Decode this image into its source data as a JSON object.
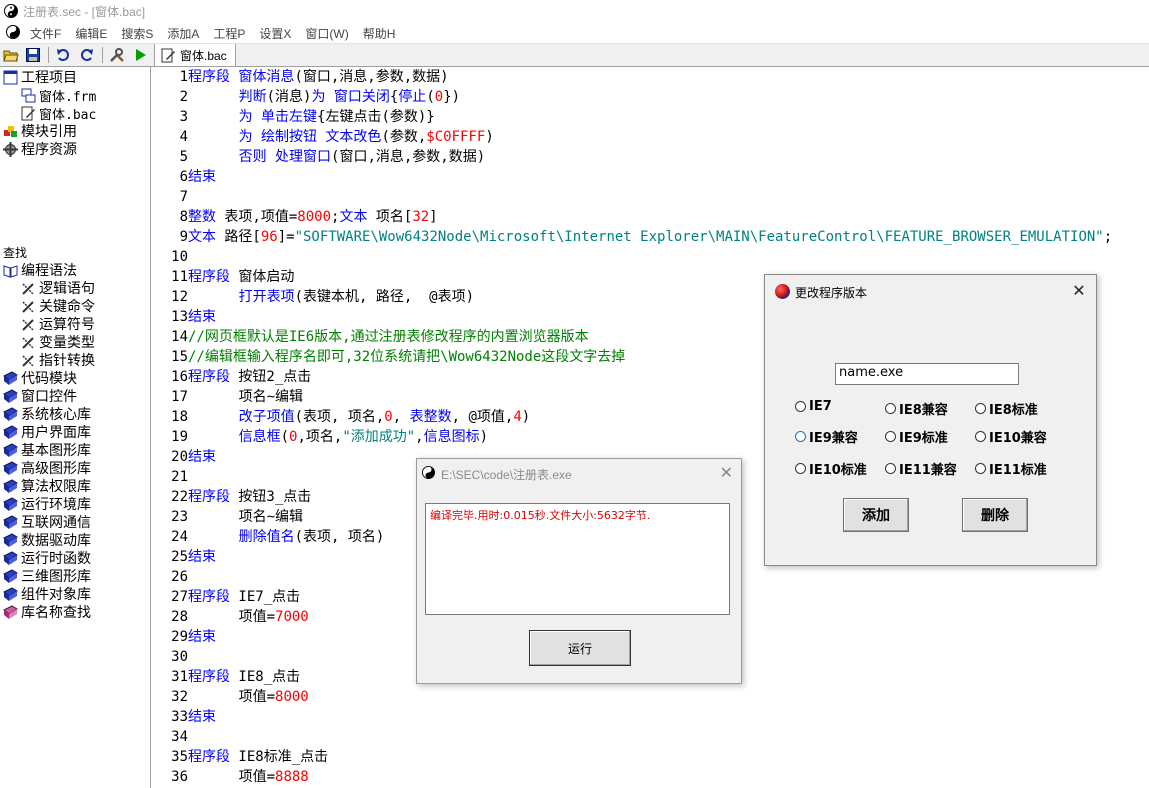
{
  "window": {
    "title": "注册表.sec - [窗体.bac]"
  },
  "menu": [
    "文件F",
    "编辑E",
    "搜索S",
    "添加A",
    "工程P",
    "设置X",
    "窗口(W)",
    "帮助H"
  ],
  "toolbar": {
    "tab_label": "窗体.bac"
  },
  "project_tree": {
    "root": "工程项目",
    "files": [
      "窗体.frm",
      "窗体.bac"
    ],
    "items": [
      "模块引用",
      "程序资源"
    ]
  },
  "search": {
    "label": "查找"
  },
  "lib_tree": {
    "root": "编程语法",
    "syntax_items": [
      "逻辑语句",
      "关键命令",
      "运算符号",
      "变量类型",
      "指针转换"
    ],
    "libraries": [
      "代码模块",
      "窗口控件",
      "系统核心库",
      "用户界面库",
      "基本图形库",
      "高级图形库",
      "算法权限库",
      "运行环境库",
      "互联网通信",
      "数据驱动库",
      "运行时函数",
      "三维图形库",
      "组件对象库"
    ],
    "last": "库名称查找"
  },
  "code_lines": [
    {
      "n": "1",
      "parts": [
        [
          "kw",
          "程序段 窗体消息"
        ],
        [
          "",
          "(窗口,消息,参数,数据)"
        ]
      ]
    },
    {
      "n": "2",
      "parts": [
        [
          "",
          "      "
        ],
        [
          "kw",
          "判断"
        ],
        [
          "",
          "(消息)"
        ],
        [
          "kw",
          "为 窗口关闭"
        ],
        [
          "",
          "{"
        ],
        [
          "kw",
          "停止"
        ],
        [
          "",
          "("
        ],
        [
          "num",
          "0"
        ],
        [
          "",
          "})"
        ]
      ]
    },
    {
      "n": "3",
      "parts": [
        [
          "",
          "      "
        ],
        [
          "kw",
          "为 单击左键"
        ],
        [
          "",
          "{左键点击(参数)}"
        ]
      ]
    },
    {
      "n": "4",
      "parts": [
        [
          "",
          "      "
        ],
        [
          "kw",
          "为 绘制按钮 文本改色"
        ],
        [
          "",
          "(参数,"
        ],
        [
          "num",
          "$C0FFFF"
        ],
        [
          "",
          ")"
        ]
      ]
    },
    {
      "n": "5",
      "parts": [
        [
          "",
          "      "
        ],
        [
          "kw",
          "否则 处理窗口"
        ],
        [
          "",
          "(窗口,消息,参数,数据)"
        ]
      ]
    },
    {
      "n": "6",
      "parts": [
        [
          "kw",
          "结束"
        ]
      ]
    },
    {
      "n": "7",
      "parts": []
    },
    {
      "n": "8",
      "parts": [
        [
          "kw",
          "整数"
        ],
        [
          "",
          " 表项,项值="
        ],
        [
          "num",
          "8000"
        ],
        [
          "",
          ";"
        ],
        [
          "kw",
          "文本"
        ],
        [
          "",
          " 项名["
        ],
        [
          "num",
          "32"
        ],
        [
          "",
          "]"
        ]
      ]
    },
    {
      "n": "9",
      "parts": [
        [
          "kw",
          "文本"
        ],
        [
          "",
          " 路径["
        ],
        [
          "num",
          "96"
        ],
        [
          "",
          "]="
        ],
        [
          "str",
          "\"SOFTWARE\\Wow6432Node\\Microsoft\\Internet Explorer\\MAIN\\FeatureControl\\FEATURE_BROWSER_EMULATION\""
        ],
        [
          "",
          ";"
        ]
      ]
    },
    {
      "n": "10",
      "parts": []
    },
    {
      "n": "11",
      "parts": [
        [
          "kw",
          "程序段"
        ],
        [
          "",
          " 窗体启动"
        ]
      ]
    },
    {
      "n": "12",
      "parts": [
        [
          "",
          "      "
        ],
        [
          "kw",
          "打开表项"
        ],
        [
          "",
          "(表键本机, 路径,  @表项)"
        ]
      ]
    },
    {
      "n": "13",
      "parts": [
        [
          "kw",
          "结束"
        ]
      ]
    },
    {
      "n": "14",
      "parts": [
        [
          "cmt",
          "//网页框默认是IE6版本,通过注册表修改程序的内置浏览器版本"
        ]
      ]
    },
    {
      "n": "15",
      "parts": [
        [
          "cmt",
          "//编辑框输入程序名即可,32位系统请把\\Wow6432Node这段文字去掉"
        ]
      ]
    },
    {
      "n": "16",
      "parts": [
        [
          "kw",
          "程序段"
        ],
        [
          "",
          " 按钮2_点击"
        ]
      ]
    },
    {
      "n": "17",
      "parts": [
        [
          "",
          "      项名~编辑"
        ]
      ]
    },
    {
      "n": "18",
      "parts": [
        [
          "",
          "      "
        ],
        [
          "kw",
          "改子项值"
        ],
        [
          "",
          "(表项, 项名,"
        ],
        [
          "num",
          "0"
        ],
        [
          "",
          ", "
        ],
        [
          "kw",
          "表整数"
        ],
        [
          "",
          ", @项值,"
        ],
        [
          "num",
          "4"
        ],
        [
          "",
          ")"
        ]
      ]
    },
    {
      "n": "19",
      "parts": [
        [
          "",
          "      "
        ],
        [
          "kw",
          "信息框"
        ],
        [
          "",
          "("
        ],
        [
          "num",
          "0"
        ],
        [
          "",
          ",项名,"
        ],
        [
          "str",
          "\"添加成功\""
        ],
        [
          "",
          ","
        ],
        [
          "kw",
          "信息图标"
        ],
        [
          "",
          ")"
        ]
      ]
    },
    {
      "n": "20",
      "parts": [
        [
          "kw",
          "结束"
        ]
      ]
    },
    {
      "n": "21",
      "parts": []
    },
    {
      "n": "22",
      "parts": [
        [
          "kw",
          "程序段"
        ],
        [
          "",
          " 按钮3_点击"
        ]
      ]
    },
    {
      "n": "23",
      "parts": [
        [
          "",
          "      项名~编辑"
        ]
      ]
    },
    {
      "n": "24",
      "parts": [
        [
          "",
          "      "
        ],
        [
          "kw",
          "删除值名"
        ],
        [
          "",
          "(表项, 项名)"
        ]
      ]
    },
    {
      "n": "25",
      "parts": [
        [
          "kw",
          "结束"
        ]
      ]
    },
    {
      "n": "26",
      "parts": []
    },
    {
      "n": "27",
      "parts": [
        [
          "kw",
          "程序段"
        ],
        [
          "",
          " IE7_点击"
        ]
      ]
    },
    {
      "n": "28",
      "parts": [
        [
          "",
          "      项值="
        ],
        [
          "num",
          "7000"
        ]
      ]
    },
    {
      "n": "29",
      "parts": [
        [
          "kw",
          "结束"
        ]
      ]
    },
    {
      "n": "30",
      "parts": []
    },
    {
      "n": "31",
      "parts": [
        [
          "kw",
          "程序段"
        ],
        [
          "",
          " IE8_点击"
        ]
      ]
    },
    {
      "n": "32",
      "parts": [
        [
          "",
          "      项值="
        ],
        [
          "num",
          "8000"
        ]
      ]
    },
    {
      "n": "33",
      "parts": [
        [
          "kw",
          "结束"
        ]
      ]
    },
    {
      "n": "34",
      "parts": []
    },
    {
      "n": "35",
      "parts": [
        [
          "kw",
          "程序段"
        ],
        [
          "",
          " IE8标准_点击"
        ]
      ]
    },
    {
      "n": "36",
      "parts": [
        [
          "",
          "      项值="
        ],
        [
          "num",
          "8888"
        ]
      ]
    }
  ],
  "version_dialog": {
    "title": "更改程序版本",
    "input_value": "name.exe",
    "radios": [
      "IE7",
      "IE8兼容",
      "IE8标准",
      "IE9兼容",
      "IE9标准",
      "IE10兼容",
      "IE10标准",
      "IE11兼容",
      "IE11标准"
    ],
    "add_label": "添加",
    "delete_label": "删除"
  },
  "run_dialog": {
    "title": "E:\\SEC\\code\\注册表.exe",
    "output": "编译完毕.用时:0.015秒.文件大小:5632字节.",
    "run_label": "运行"
  },
  "colors": {
    "keyword": "#0000ff",
    "comment": "#008000",
    "number": "#ff0000",
    "string": "#008080",
    "output_text": "#e00000"
  }
}
